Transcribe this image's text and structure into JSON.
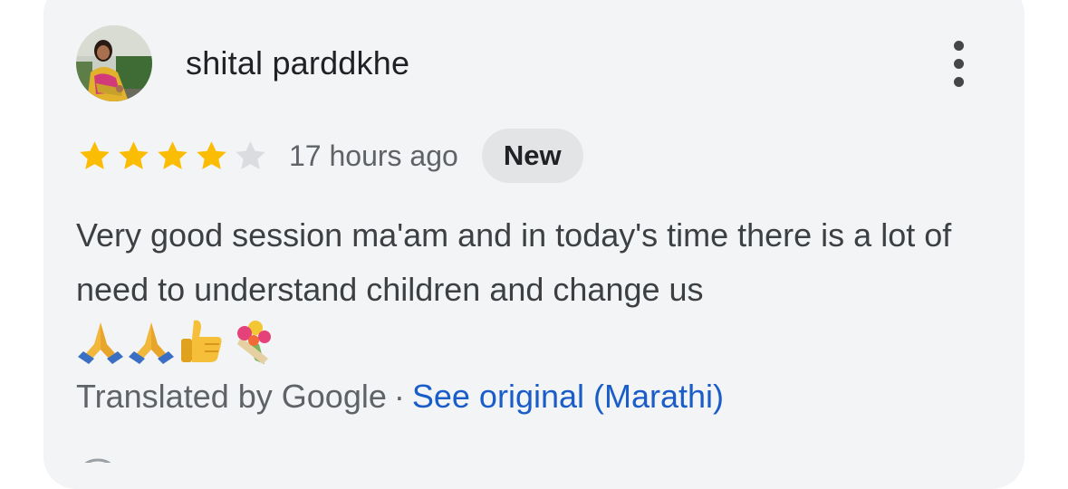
{
  "review": {
    "reviewer_name": "shital parddkhe",
    "rating": 4,
    "rating_max": 5,
    "time_ago": "17 hours ago",
    "badge": "New",
    "text": "Very good session ma'am and in today's time there is a lot of need to understand children and change us",
    "emojis": [
      "folded-hands",
      "folded-hands",
      "thumbs-up",
      "bouquet"
    ],
    "translation_note": "Translated by Google",
    "separator": "·",
    "see_original_label": "See original (Marathi)"
  },
  "icons": {
    "menu": "more-vert-icon",
    "star_filled_color": "#fbbc04",
    "star_empty_color": "#dadce0"
  },
  "colors": {
    "card_background": "#f3f4f6",
    "link": "#1a5dc9",
    "badge_background": "#e3e4e6"
  }
}
